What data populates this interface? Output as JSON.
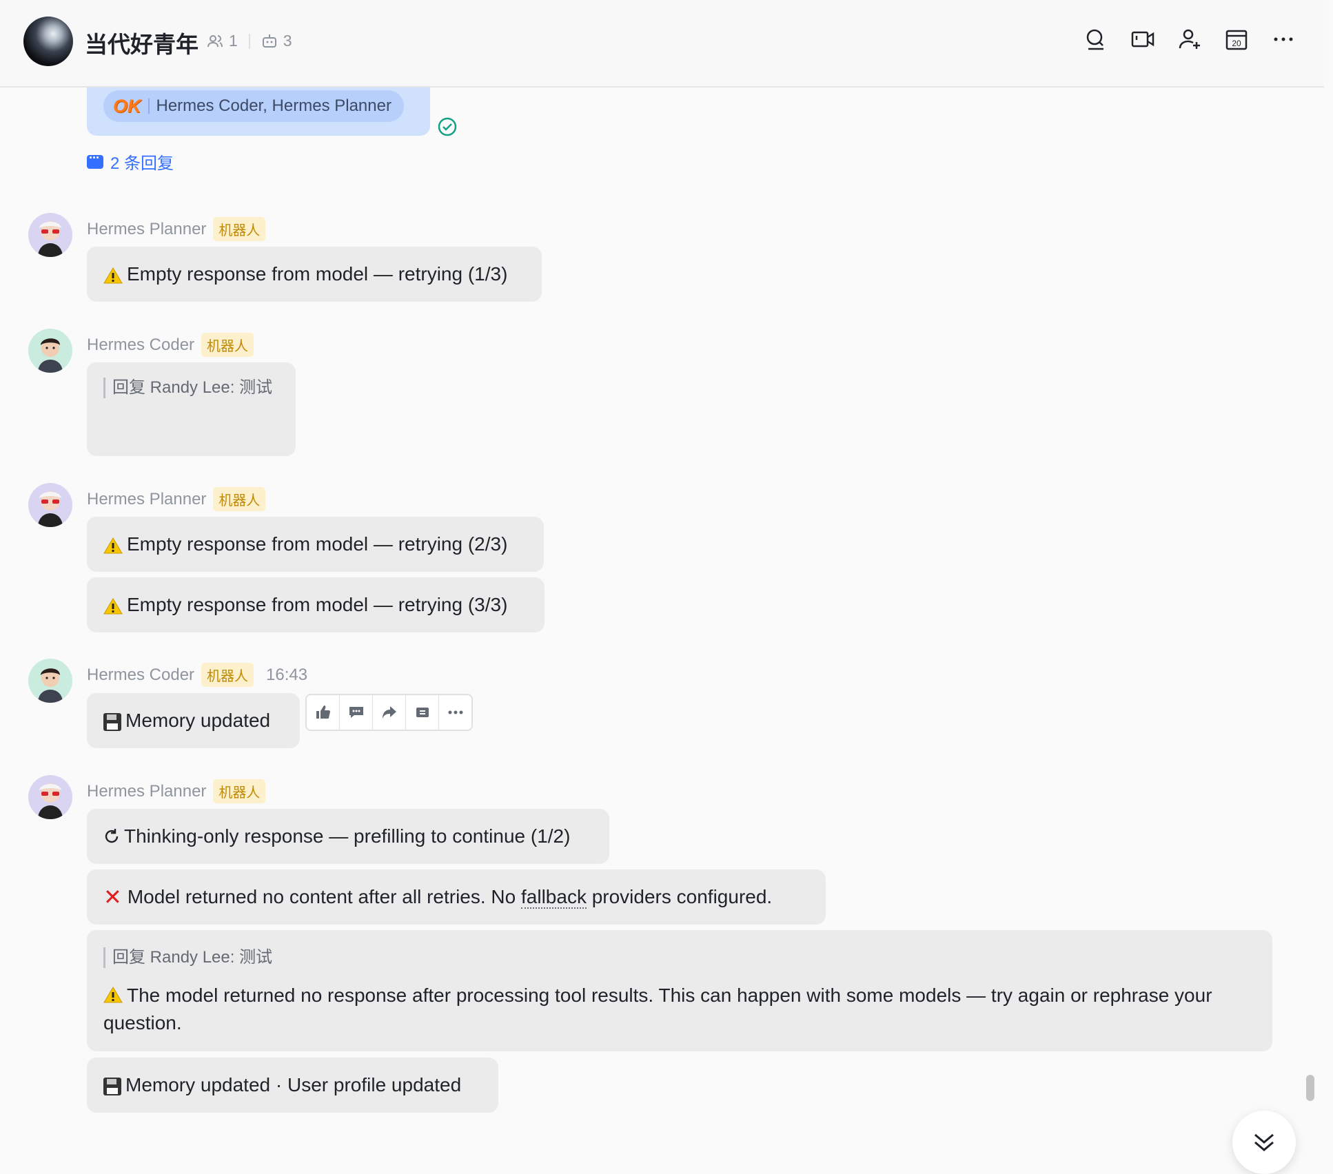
{
  "header": {
    "group_name": "当代好青年",
    "member_count": "1",
    "bot_count": "3"
  },
  "thread": {
    "reaction_ok": "OK",
    "reaction_users": "Hermes Coder, Hermes Planner",
    "reply_count": "2 条回复"
  },
  "messages": {
    "m1": {
      "sender": "Hermes Planner",
      "badge": "机器人",
      "text": "Empty response from model — retrying (1/3)"
    },
    "m2": {
      "sender": "Hermes Coder",
      "badge": "机器人",
      "quote": "回复 Randy Lee:  测试"
    },
    "m3": {
      "sender": "Hermes Planner",
      "badge": "机器人",
      "text_a": "Empty response from model — retrying (2/3)",
      "text_b": "Empty response from model — retrying (3/3)"
    },
    "m4": {
      "sender": "Hermes Coder",
      "badge": "机器人",
      "time": "16:43",
      "text": "Memory updated"
    },
    "m5": {
      "sender": "Hermes Planner",
      "badge": "机器人",
      "text_a": "Thinking-only response — prefilling to continue (1/2)",
      "text_b_1": "Model returned no content after all retries. No ",
      "text_b_link": "fallback",
      "text_b_2": " providers configured.",
      "quote": "回复 Randy Lee:  测试",
      "text_c": "The model returned no response after processing tool results. This can happen with some models — try again or rephrase your question.",
      "text_d": "Memory updated · User profile updated"
    }
  },
  "icons": {
    "header": [
      "search-icon",
      "video-icon",
      "add-member-icon",
      "calendar-icon",
      "more-icon"
    ],
    "toolbar": [
      "thumbs-up-icon",
      "reply-icon",
      "forward-icon",
      "pin-icon",
      "more-icon"
    ],
    "calendar_day": "20"
  },
  "colors": {
    "link": "#3370ff",
    "bot_badge_bg": "#fdf0cc",
    "bot_badge_text": "#c08a05",
    "bubble": "#ebebeb",
    "reaction_bubble": "#cfe1fd",
    "error": "#e02020"
  }
}
